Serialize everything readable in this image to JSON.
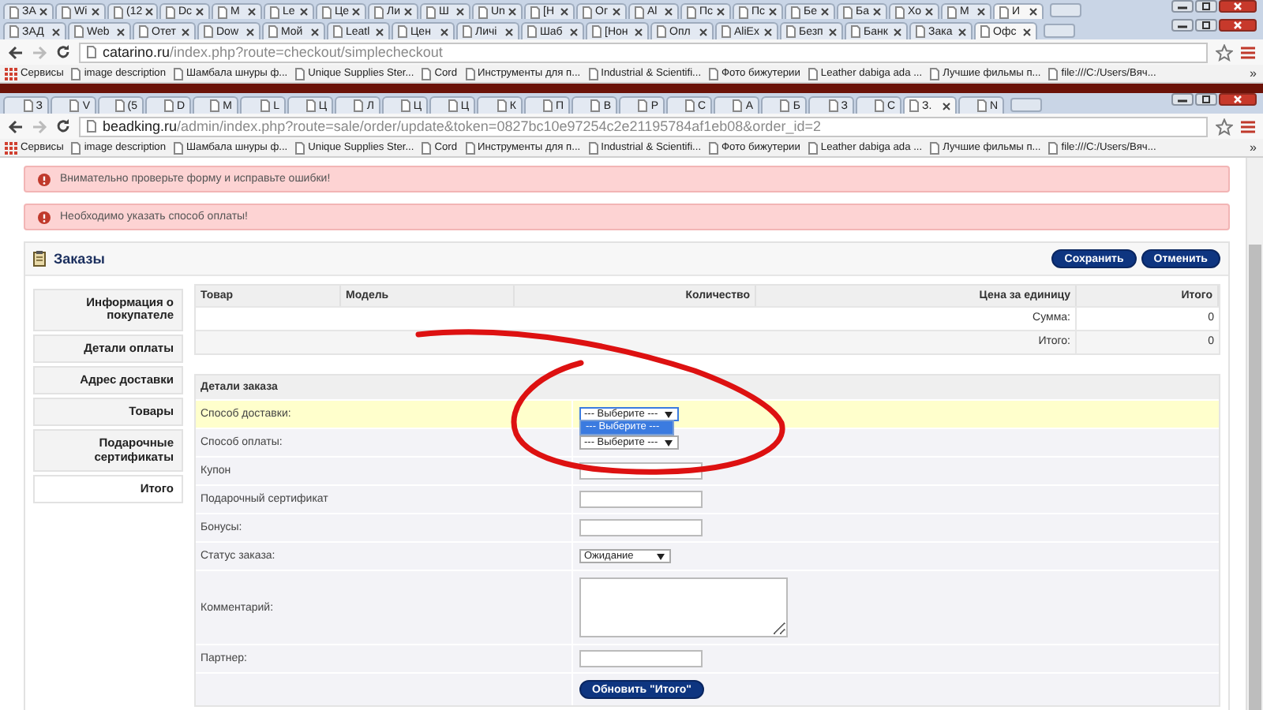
{
  "windows": [
    {
      "tabs": [
        {
          "label": "ЗА",
          "selected": false
        },
        {
          "label": "Wi",
          "selected": false
        },
        {
          "label": "(12",
          "selected": false
        },
        {
          "label": "Dc",
          "selected": false
        },
        {
          "label": "M",
          "selected": false
        },
        {
          "label": "Le",
          "selected": false
        },
        {
          "label": "Це",
          "selected": false
        },
        {
          "label": "Ли",
          "selected": false
        },
        {
          "label": "Ш",
          "selected": false
        },
        {
          "label": "Un",
          "selected": false
        },
        {
          "label": "[Н",
          "selected": false
        },
        {
          "label": "Ог",
          "selected": false
        },
        {
          "label": "Al",
          "selected": false
        },
        {
          "label": "Пс",
          "selected": false
        },
        {
          "label": "Пс",
          "selected": false
        },
        {
          "label": "Бе",
          "selected": false
        },
        {
          "label": "Ба",
          "selected": false
        },
        {
          "label": "Хо",
          "selected": false
        },
        {
          "label": "М",
          "selected": false
        },
        {
          "label": "И",
          "selected": true
        }
      ],
      "show_close": true
    },
    {
      "tabs": [
        {
          "label": "ЗАД",
          "selected": false
        },
        {
          "label": "Web",
          "selected": false
        },
        {
          "label": "Отет",
          "selected": false
        },
        {
          "label": "Dow",
          "selected": false
        },
        {
          "label": "Мой",
          "selected": false
        },
        {
          "label": "Leatl",
          "selected": false
        },
        {
          "label": "Цен",
          "selected": false
        },
        {
          "label": "Личі",
          "selected": false
        },
        {
          "label": "Шаб",
          "selected": false
        },
        {
          "label": "[Нон",
          "selected": false
        },
        {
          "label": "Опл",
          "selected": false
        },
        {
          "label": "AliEx",
          "selected": false
        },
        {
          "label": "Безп",
          "selected": false
        },
        {
          "label": "Банк",
          "selected": false
        },
        {
          "label": "Зака",
          "selected": false
        },
        {
          "label": "Офс",
          "selected": true
        }
      ],
      "show_close": true,
      "address": {
        "host": "catarino.ru",
        "path": "/index.php?route=checkout/simplecheckout"
      },
      "bookmarks": [
        "Сервисы",
        "image description",
        "Шамбала шнуры ф...",
        "Unique Supplies Ster...",
        "Cord",
        "Инструменты для п...",
        "Industrial & Scientifi...",
        "Фото бижутерии",
        "Leather dabiga ada ...",
        "Лучшие фильмы п...",
        "file:///C:/Users/Вяч..."
      ],
      "bookmarks_more": "»"
    },
    {
      "tabs": [
        {
          "label": "З",
          "selected": false
        },
        {
          "label": "V",
          "selected": false
        },
        {
          "label": "(5",
          "selected": false
        },
        {
          "label": "D",
          "selected": false
        },
        {
          "label": "M",
          "selected": false
        },
        {
          "label": "L",
          "selected": false
        },
        {
          "label": "Ц",
          "selected": false
        },
        {
          "label": "Л",
          "selected": false
        },
        {
          "label": "Ц",
          "selected": false
        },
        {
          "label": "Ц",
          "selected": false
        },
        {
          "label": "К",
          "selected": false
        },
        {
          "label": "П",
          "selected": false
        },
        {
          "label": "В",
          "selected": false
        },
        {
          "label": "Р",
          "selected": false
        },
        {
          "label": "С",
          "selected": false
        },
        {
          "label": "А",
          "selected": false
        },
        {
          "label": "Б",
          "selected": false
        },
        {
          "label": "З",
          "selected": false
        },
        {
          "label": "С",
          "selected": false
        },
        {
          "label": "З.",
          "selected": true
        },
        {
          "label": "N",
          "selected": false
        }
      ],
      "show_close": false,
      "address": {
        "host": "beadking.ru",
        "path": "/admin/index.php?route=sale/order/update&token=0827bc10e97254c2e21195784af1eb08&order_id=2"
      },
      "bookmarks": [
        "Сервисы",
        "image description",
        "Шамбала шнуры ф...",
        "Unique Supplies Ster...",
        "Cord",
        "Инструменты для п...",
        "Industrial & Scientifi...",
        "Фото бижутерии",
        "Leather dabiga ada ...",
        "Лучшие фильмы п...",
        "file:///C:/Users/Вяч..."
      ],
      "bookmarks_more": "»"
    }
  ],
  "alerts": [
    "Внимательно проверьте форму и исправьте ошибки!",
    "Необходимо указать способ оплаты!"
  ],
  "panel": {
    "title": "Заказы",
    "buttons": [
      "Сохранить",
      "Отменить"
    ],
    "sidebar": {
      "items": [
        {
          "label": "Информация о покупателе",
          "selected": false
        },
        {
          "label": "Детали оплаты",
          "selected": false
        },
        {
          "label": "Адрес доставки",
          "selected": false
        },
        {
          "label": "Товары",
          "selected": false
        },
        {
          "label": "Подарочные сертификаты",
          "selected": false
        },
        {
          "label": "Итого",
          "selected": true
        }
      ]
    },
    "products": {
      "columns": [
        "Товар",
        "Модель",
        "Количество",
        "Цена за единицу",
        "Итого"
      ],
      "totals": [
        {
          "label": "Сумма:",
          "value": "0"
        },
        {
          "label": "Итого:",
          "value": "0"
        }
      ]
    },
    "details": {
      "heading": "Детали заказа",
      "rows": [
        {
          "kind": "select",
          "label": "Способ доставки:",
          "value": "--- Выберите ---",
          "highlighted": true,
          "open": true,
          "options": [
            {
              "label": "--- Выберите ---",
              "selected": true
            }
          ]
        },
        {
          "kind": "select",
          "label": "Способ оплаты:",
          "value": "--- Выберите ---",
          "highlighted": false,
          "open": false
        },
        {
          "kind": "input",
          "label": "Купон",
          "highlighted": false
        },
        {
          "kind": "input",
          "label": "Подарочный сертификат",
          "highlighted": false
        },
        {
          "kind": "input",
          "label": "Бонусы:",
          "highlighted": false
        },
        {
          "kind": "select",
          "label": "Статус заказа:",
          "value": "Ожидание",
          "highlighted": false,
          "open": false
        },
        {
          "kind": "textarea",
          "label": "Комментарий:",
          "highlighted": false
        },
        {
          "kind": "input",
          "label": "Партнер:",
          "highlighted": false
        },
        {
          "kind": "button",
          "text": "Обновить \"Итого\"",
          "highlighted": false
        }
      ]
    }
  }
}
